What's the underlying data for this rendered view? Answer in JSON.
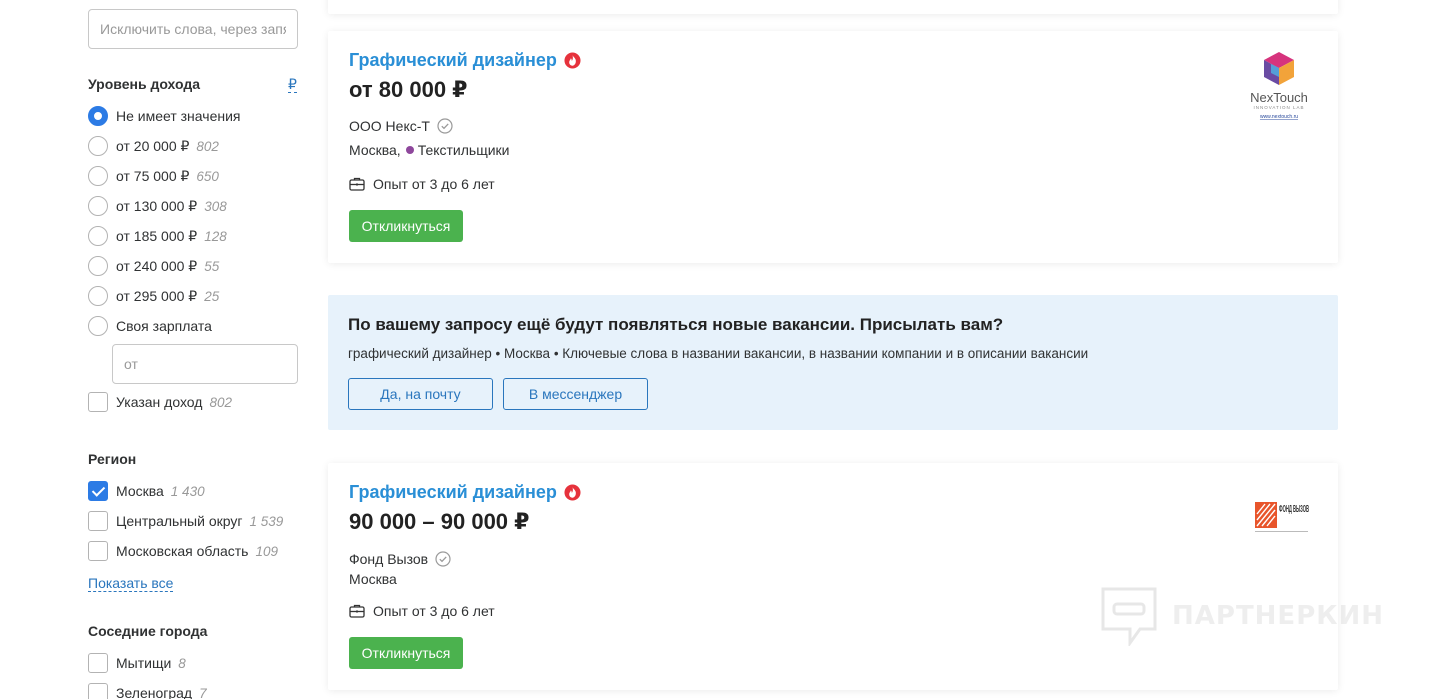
{
  "filters": {
    "exclude_placeholder": "Исключить слова, через запятую",
    "income": {
      "title": "Уровень дохода",
      "currency": "₽",
      "options": [
        {
          "label": "Не имеет значения",
          "count": ""
        },
        {
          "label": "от 20 000 ₽",
          "count": "802"
        },
        {
          "label": "от 75 000 ₽",
          "count": "650"
        },
        {
          "label": "от 130 000 ₽",
          "count": "308"
        },
        {
          "label": "от 185 000 ₽",
          "count": "128"
        },
        {
          "label": "от 240 000 ₽",
          "count": "55"
        },
        {
          "label": "от 295 000 ₽",
          "count": "25"
        },
        {
          "label": "Своя зарплата",
          "count": ""
        }
      ],
      "from_placeholder": "от",
      "specified": {
        "label": "Указан доход",
        "count": "802"
      }
    },
    "region": {
      "title": "Регион",
      "options": [
        {
          "label": "Москва",
          "count": "1 430"
        },
        {
          "label": "Центральный округ",
          "count": "1 539"
        },
        {
          "label": "Московская область",
          "count": "109"
        }
      ],
      "show_all": "Показать все"
    },
    "nearby": {
      "title": "Соседние города",
      "options": [
        {
          "label": "Мытищи",
          "count": "8"
        },
        {
          "label": "Зеленоград",
          "count": "7"
        }
      ]
    }
  },
  "vacancies": [
    {
      "title": "Графический дизайнер",
      "salary": "от 80 000 ₽",
      "company": "ООО Некс-Т",
      "city": "Москва,",
      "metro": "Текстильщики",
      "experience": "Опыт от 3 до 6 лет",
      "apply": "Откликнуться",
      "logo": {
        "name": "NexTouch",
        "tagline": "INNOVATION LAB",
        "url": "www.nextouch.ru"
      }
    },
    {
      "title": "Графический дизайнер",
      "salary": "90 000 – 90 000 ₽",
      "company": "Фонд Вызов",
      "city": "Москва",
      "metro": "",
      "experience": "Опыт от 3 до 6 лет",
      "apply": "Откликнуться",
      "logo": {
        "name": "ФОНД ВЫЗОВ"
      }
    }
  ],
  "subscription": {
    "title": "По вашему запросу ещё будут появляться новые вакансии. Присылать вам?",
    "description": "графический дизайнер • Москва • Ключевые слова в названии вакансии, в названии компании и в описании вакансии",
    "email_button": "Да, на почту",
    "messenger_button": "В мессенджер"
  },
  "watermark": "ПАРТНЕРКИН",
  "colors": {
    "accent": "#2a8fd6",
    "apply": "#4bb24e",
    "checked": "#2c7be5",
    "metro": "#8e479c"
  }
}
